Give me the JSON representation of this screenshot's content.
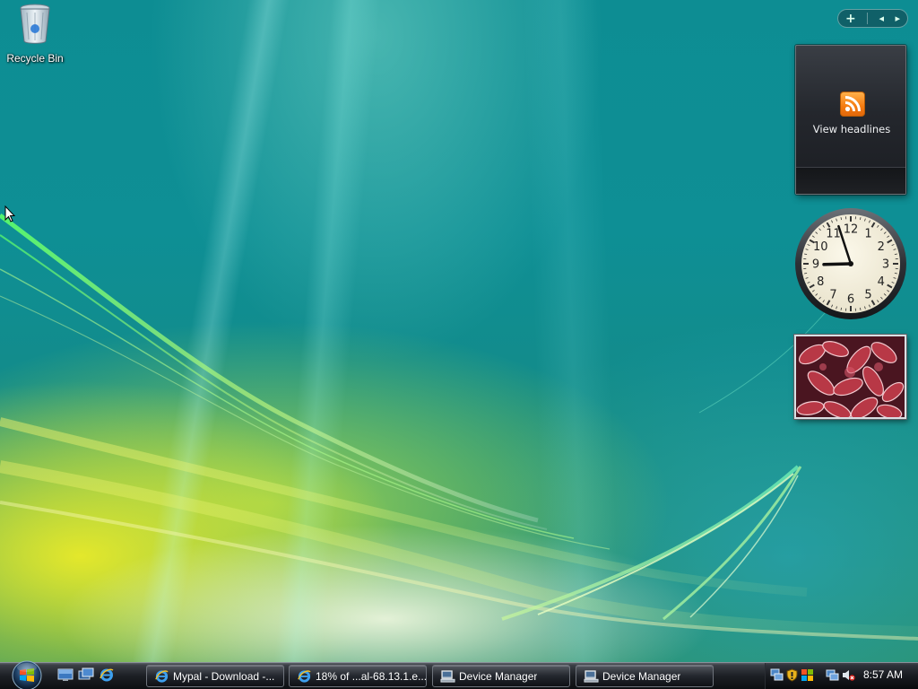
{
  "desktop": {
    "icons": [
      {
        "label": "Recycle Bin",
        "icon": "recycle-bin-icon"
      }
    ]
  },
  "sidebar": {
    "controls": {
      "add": "+",
      "prev": "◂",
      "next": "▸"
    },
    "feed_gadget": {
      "caption": "View headlines",
      "icon": "rss-icon"
    },
    "clock_gadget": {
      "numerals": [
        "12",
        "1",
        "2",
        "3",
        "4",
        "5",
        "6",
        "7",
        "8",
        "9",
        "10",
        "11"
      ],
      "hour": 8,
      "minute": 57
    },
    "slideshow_gadget": {
      "subject": "frost-covered red leaves"
    }
  },
  "taskbar": {
    "start": {
      "icon": "windows-orb-icon"
    },
    "quick_launch": [
      "show-desktop-icon",
      "switch-windows-icon",
      "internet-explorer-icon"
    ],
    "tasks": [
      {
        "label": "Mypal - Download -...",
        "icon": "internet-explorer-icon"
      },
      {
        "label": "18% of ...al-68.13.1.e...",
        "icon": "internet-explorer-icon"
      },
      {
        "label": "Device Manager",
        "icon": "device-manager-icon"
      },
      {
        "label": "Device Manager",
        "icon": "device-manager-icon"
      }
    ],
    "tray": {
      "icons": [
        "network-icon",
        "security-shield-icon",
        "windows-update-icon",
        "network-status-icon",
        "volume-muted-icon"
      ],
      "time": "8:57 AM"
    }
  },
  "colors": {
    "accent_orange": "#f57b10",
    "taskbar_dark": "#1c1f24",
    "wallpaper_teal": "#0e8f95"
  }
}
